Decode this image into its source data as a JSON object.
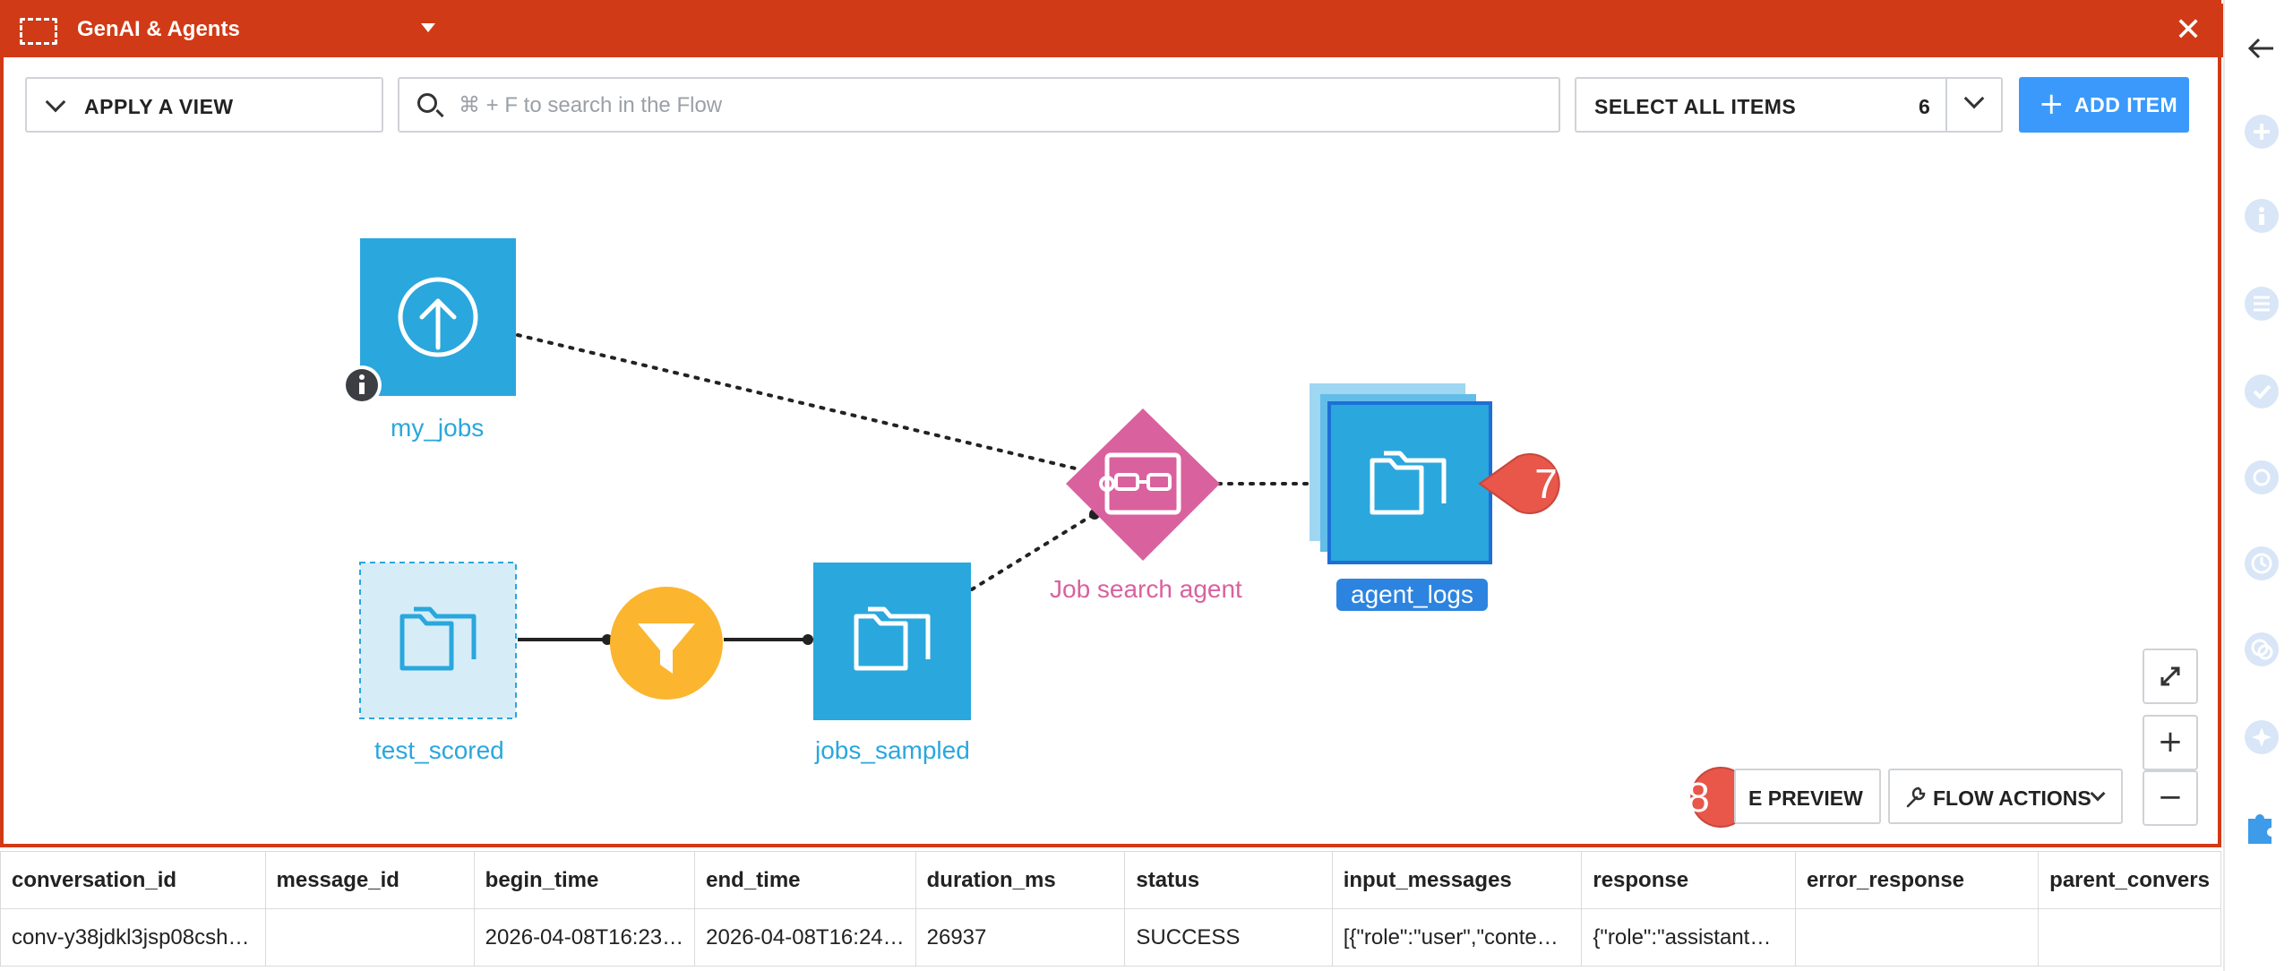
{
  "zone": {
    "title": "GenAI & Agents",
    "accent_color": "#d13a16",
    "close_icon": "close-icon"
  },
  "toolbar": {
    "view_label": "APPLY A VIEW",
    "search_placeholder": "⌘ + F to search in the Flow",
    "select_all_label": "SELECT ALL ITEMS",
    "select_all_count": "6",
    "add_item_label": "ADD ITEM"
  },
  "flow": {
    "nodes": {
      "my_jobs": {
        "label": "my_jobs",
        "icon": "upload-icon"
      },
      "test_scored": {
        "label": "test_scored",
        "icon": "folder-icon"
      },
      "filter": {
        "icon": "filter-icon"
      },
      "jobs_sampled": {
        "label": "jobs_sampled",
        "icon": "folder-icon"
      },
      "agent": {
        "label": "Job search agent",
        "icon": "agent-icon"
      },
      "agent_logs": {
        "label": "agent_logs",
        "icon": "folder-icon"
      }
    },
    "callouts": {
      "seven": "7",
      "eight": "8"
    },
    "preview_button_label": "E PREVIEW",
    "flow_actions_label": "FLOW ACTIONS"
  },
  "preview": {
    "columns": [
      "conversation_id",
      "message_id",
      "begin_time",
      "end_time",
      "duration_ms",
      "status",
      "input_messages",
      "response",
      "error_response",
      "parent_convers"
    ],
    "rows": [
      [
        "conv-y38jdkl3jsp08csh…",
        "",
        "2026-04-08T16:23…",
        "2026-04-08T16:24…",
        "26937",
        "SUCCESS",
        "[{\"role\":\"user\",\"conte…",
        "{\"role\":\"assistant…",
        "",
        ""
      ]
    ]
  },
  "colors": {
    "dataset_blue": "#2aa7dd",
    "recipe_pink": "#d9619e",
    "filter_yellow": "#fbb52f",
    "callout_red": "#e8574a",
    "add_button": "#3b99fc"
  }
}
